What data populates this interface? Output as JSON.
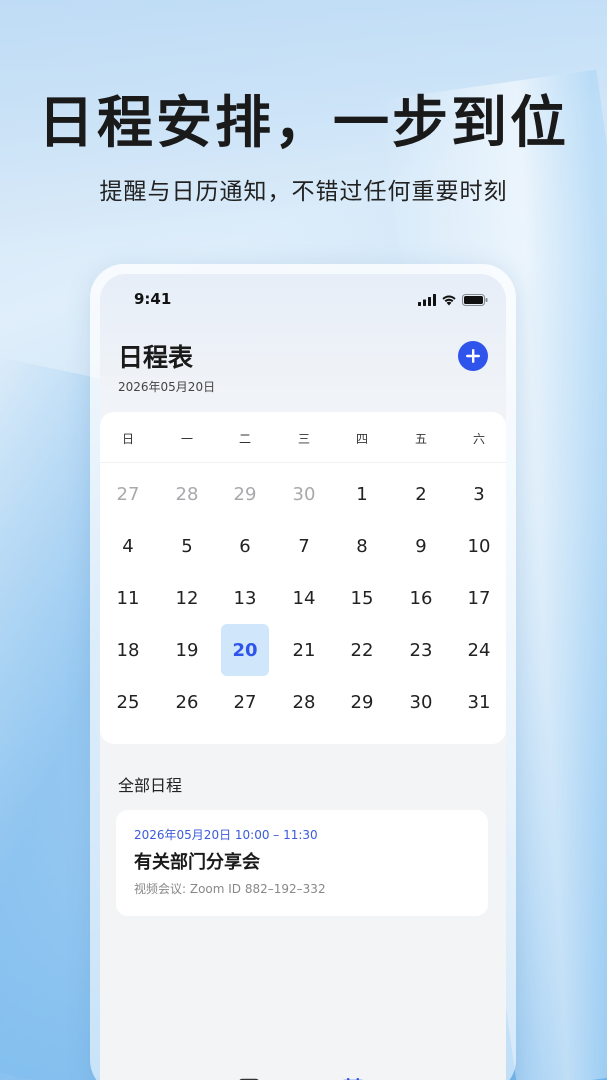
{
  "headline": "日程安排，一步到位",
  "subline": "提醒与日历通知，不错过任何重要时刻",
  "status": {
    "time": "9:41"
  },
  "app": {
    "title": "日程表",
    "date": "2026年05月20日"
  },
  "calendar": {
    "weekdays": [
      "日",
      "一",
      "二",
      "三",
      "四",
      "五",
      "六"
    ],
    "weeks": [
      [
        "27",
        "28",
        "29",
        "30",
        "1",
        "2",
        "3"
      ],
      [
        "4",
        "5",
        "6",
        "7",
        "8",
        "9",
        "10"
      ],
      [
        "11",
        "12",
        "13",
        "14",
        "15",
        "16",
        "17"
      ],
      [
        "18",
        "19",
        "20",
        "21",
        "22",
        "23",
        "24"
      ],
      [
        "25",
        "26",
        "27",
        "28",
        "29",
        "30",
        "31"
      ]
    ],
    "muted_first_row_count": 4,
    "selected_day": "20",
    "accent_color": "#2f54eb"
  },
  "schedule": {
    "section_title": "全部日程",
    "events": [
      {
        "time": "2026年05月20日  10:00 – 11:30",
        "title": "有关部门分享会",
        "desc": "视频会议: Zoom ID 882–192–332"
      }
    ]
  },
  "tabs": {
    "icons": [
      "inbox-icon",
      "document-icon",
      "calendar-icon",
      "profile-icon"
    ],
    "active": "calendar-icon"
  }
}
